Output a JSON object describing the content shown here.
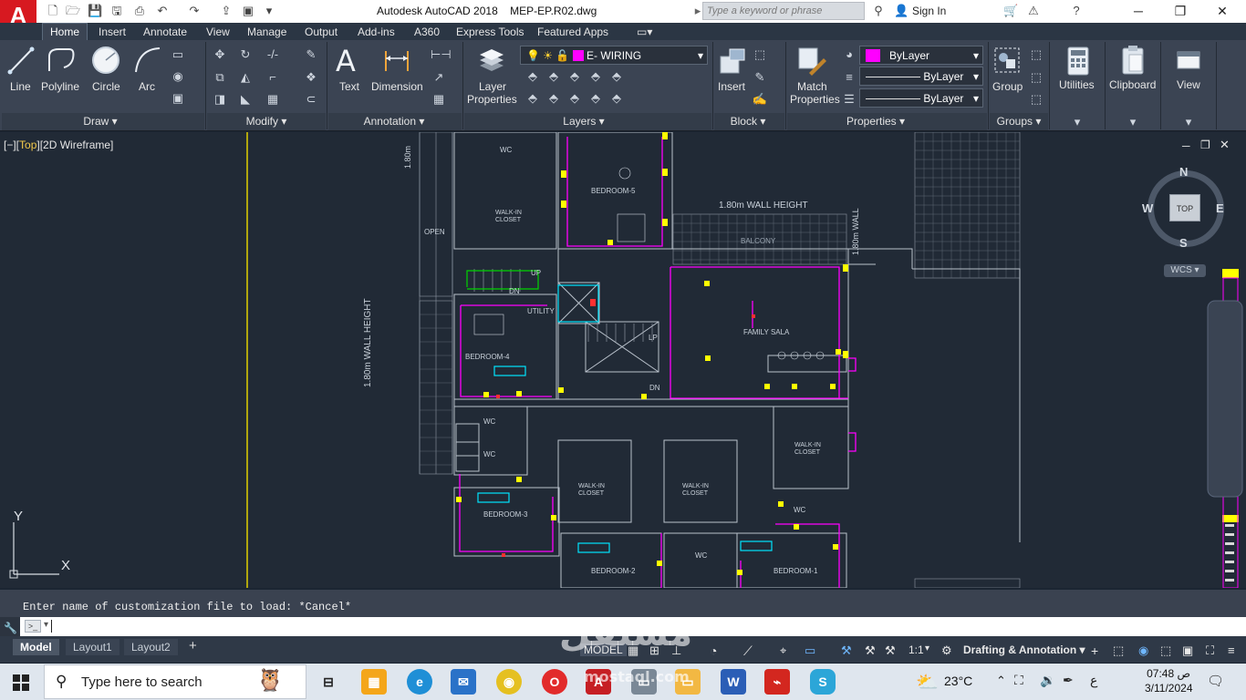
{
  "title_bar": {
    "app_logo": "A",
    "app_name": "Autodesk AutoCAD 2018",
    "document": "MEP-EP.R02.dwg",
    "search_placeholder": "Type a keyword or phrase",
    "sign_in": "Sign In"
  },
  "ribbon_tabs": [
    "Home",
    "Insert",
    "Annotate",
    "View",
    "Manage",
    "Output",
    "Add-ins",
    "A360",
    "Express Tools",
    "Featured Apps"
  ],
  "active_tab": "Home",
  "panels": {
    "draw": {
      "title": "Draw",
      "tools": [
        "Line",
        "Polyline",
        "Circle",
        "Arc"
      ]
    },
    "modify": {
      "title": "Modify"
    },
    "annotation": {
      "title": "Annotation",
      "tools": [
        "Text",
        "Dimension"
      ]
    },
    "layers": {
      "title": "Layers",
      "tools": [
        "Layer",
        "Properties"
      ],
      "current_layer": "E- WIRING"
    },
    "block": {
      "title": "Block",
      "tools": [
        "Insert"
      ]
    },
    "properties": {
      "title": "Properties",
      "tools": [
        "Match",
        "Properties"
      ],
      "color": "ByLayer",
      "linetype": "ByLayer",
      "lineweight": "ByLayer"
    },
    "groups": {
      "title": "Groups",
      "tools": [
        "Group"
      ]
    },
    "utilities": {
      "title": "Utilities"
    },
    "clipboard": {
      "title": "Clipboard"
    },
    "view": {
      "title": "View"
    }
  },
  "viewport": {
    "label_open": "[−][",
    "label_view": "Top",
    "label_close": "][2D Wireframe]",
    "viewcube": {
      "north": "N",
      "south": "S",
      "east": "E",
      "west": "W",
      "face": "TOP",
      "ucs": "WCS"
    },
    "ucs_axes": {
      "x": "X",
      "y": "Y"
    },
    "drawing_labels": {
      "wall_height_top": "1.80m WALL HEIGHT",
      "wall_height_left": "1.80m WALL HEIGHT",
      "wall_height_mid": "1.80m WALL",
      "wall_height_topleft": "1.80m",
      "balcony": "BALCONY",
      "bedroom5": "BEDROOM-5",
      "bedroom4": "BEDROOM-4",
      "bedroom3": "BEDROOM-3",
      "bedroom2": "BEDROOM-2",
      "bedroom1": "BEDROOM-1",
      "family_sala": "FAMILY SALA",
      "walk_in_closet": "WALK-IN CLOSET",
      "wc": "WC",
      "utility": "UTILITY",
      "up": "UP",
      "dn": "DN",
      "open": "OPEN",
      "lp": "LP"
    }
  },
  "command": {
    "history": "Enter name of customization file to load: *Cancel*",
    "prompt_icon": ">_"
  },
  "layout_tabs": [
    "Model",
    "Layout1",
    "Layout2"
  ],
  "active_layout": "Model",
  "status": {
    "model": "MODEL",
    "scale": "1:1",
    "workspace": "Drafting & Annotation"
  },
  "taskbar": {
    "search_placeholder": "Type here to search",
    "weather": "23°C",
    "lang": "ع",
    "time": "07:48 ص",
    "date": "3/11/2024"
  },
  "watermark": {
    "text": "مستقل",
    "sub": "mostaql.com"
  },
  "colors": {
    "autocad_red": "#d71920",
    "ribbon_bg": "#3b4453",
    "viewport_bg": "#212a36",
    "magenta_wiring": "#ff00ff",
    "cyan": "#00e5ff",
    "yellow": "#ffff00",
    "green": "#00d400"
  }
}
